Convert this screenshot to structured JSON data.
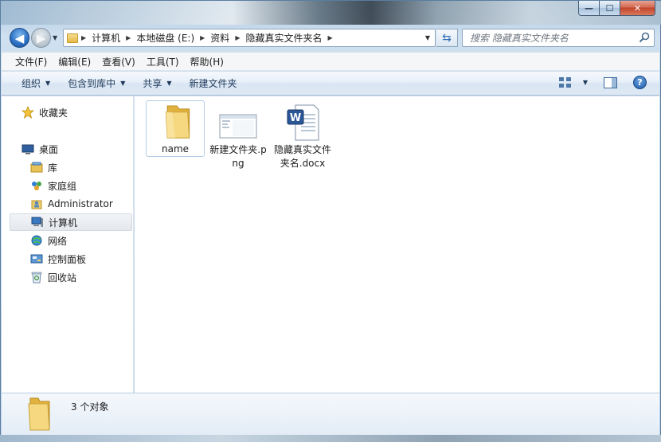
{
  "window": {
    "controls": {
      "minimize": "—",
      "maximize": "☐",
      "close": "✕"
    }
  },
  "nav": {
    "back_glyph": "◀",
    "forward_glyph": "▶",
    "breadcrumb": [
      "计算机",
      "本地磁盘 (E:)",
      "资料",
      "隐藏真实文件夹名"
    ],
    "search_placeholder": "搜索 隐藏真实文件夹名"
  },
  "menu": {
    "items": [
      "文件(F)",
      "编辑(E)",
      "查看(V)",
      "工具(T)",
      "帮助(H)"
    ]
  },
  "toolbar": {
    "organize": "组织",
    "include_in_library": "包含到库中",
    "share": "共享",
    "new_folder": "新建文件夹",
    "help": "?"
  },
  "sidebar": {
    "items": [
      {
        "label": "收藏夹",
        "icon": "star-icon"
      },
      {
        "label": "桌面",
        "icon": "desktop-icon"
      },
      {
        "label": "库",
        "icon": "library-icon"
      },
      {
        "label": "家庭组",
        "icon": "homegroup-icon"
      },
      {
        "label": "Administrator",
        "icon": "user-folder-icon"
      },
      {
        "label": "计算机",
        "icon": "computer-icon",
        "selected": true
      },
      {
        "label": "网络",
        "icon": "network-icon"
      },
      {
        "label": "控制面板",
        "icon": "control-panel-icon"
      },
      {
        "label": "回收站",
        "icon": "recycle-bin-icon"
      }
    ]
  },
  "files": [
    {
      "name": "name",
      "type": "folder",
      "icon": "folder-icon"
    },
    {
      "name": "新建文件夹.png",
      "type": "image",
      "icon": "png-thumbnail-icon"
    },
    {
      "name": "隐藏真实文件夹名.docx",
      "type": "document",
      "icon": "word-document-icon"
    }
  ],
  "status": {
    "item_count": "3 个对象"
  },
  "colors": {
    "accent": "#1e395b",
    "selection_border": "#b4cde6",
    "word_blue": "#2b5797",
    "folder_yellow": "#f2d276"
  }
}
